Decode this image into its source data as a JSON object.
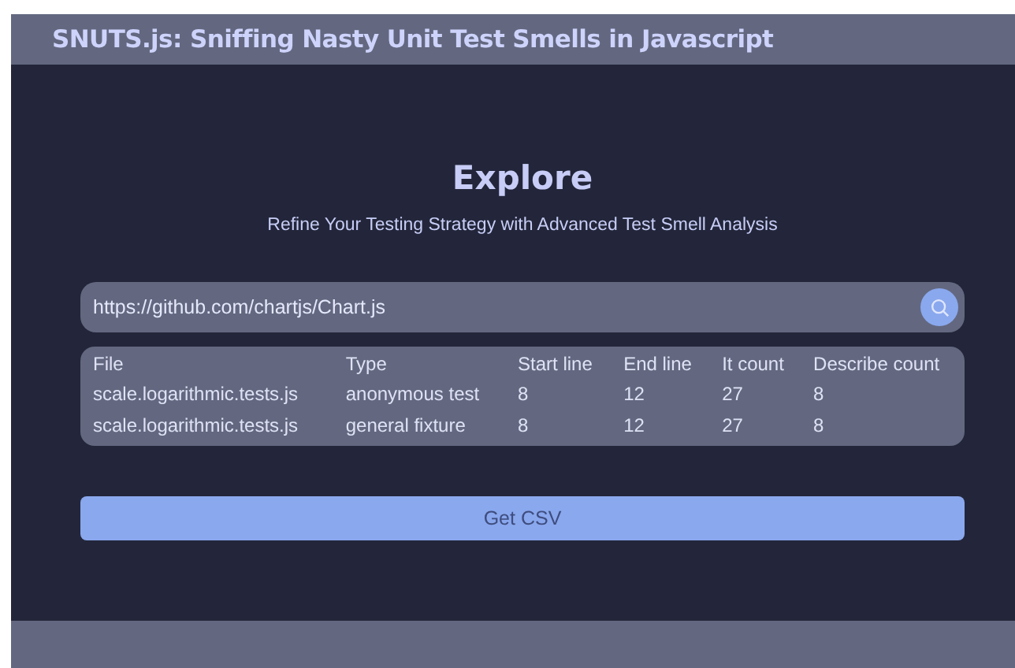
{
  "header": {
    "title": "SNUTS.js: Sniffing Nasty Unit Test Smells in Javascript"
  },
  "hero": {
    "title": "Explore",
    "subtitle": "Refine Your Testing Strategy with Advanced Test Smell Analysis"
  },
  "search": {
    "value": "https://github.com/chartjs/Chart.js"
  },
  "table": {
    "columns": [
      "File",
      "Type",
      "Start line",
      "End line",
      "It count",
      "Describe count"
    ],
    "rows": [
      [
        "scale.logarithmic.tests.js",
        "anonymous test",
        "8",
        "12",
        "27",
        "8"
      ],
      [
        "scale.logarithmic.tests.js",
        "general fixture",
        "8",
        "12",
        "27",
        "8"
      ]
    ]
  },
  "csv_button": {
    "label": "Get CSV",
    "disabled": true
  }
}
